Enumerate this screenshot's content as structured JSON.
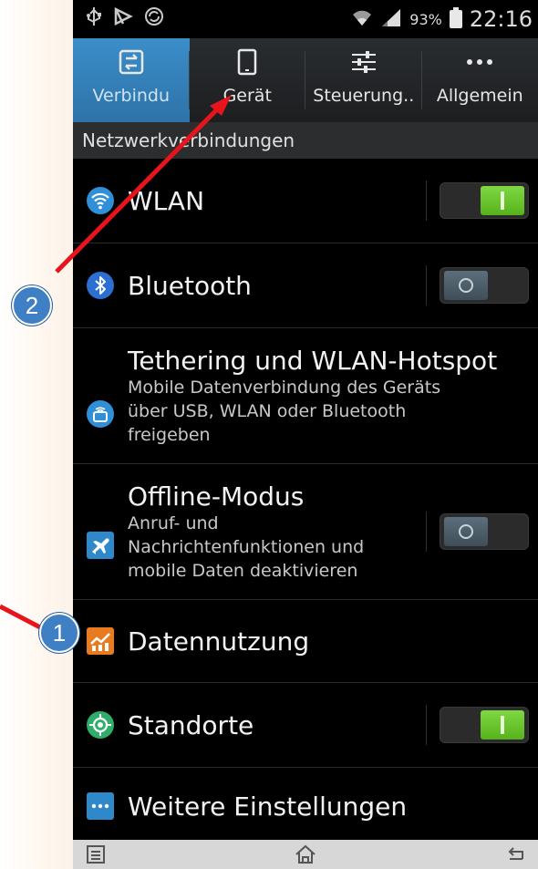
{
  "status_bar": {
    "battery_percent": "93%",
    "time": "22:16",
    "icons": [
      "usb-icon",
      "media-icon",
      "sync-icon",
      "wifi-signal-icon",
      "cell-signal-icon",
      "battery-icon"
    ]
  },
  "tabs": [
    {
      "label": "Verbindu",
      "icon": "connections-icon",
      "active": true
    },
    {
      "label": "Gerät",
      "icon": "device-icon",
      "active": false
    },
    {
      "label": "Steuerung..",
      "icon": "controls-icon",
      "active": false
    },
    {
      "label": "Allgemein",
      "icon": "more-icon",
      "active": false
    }
  ],
  "section_header": "Netzwerkverbindungen",
  "settings": {
    "wlan": {
      "title": "WLAN",
      "toggle": "on"
    },
    "bluetooth": {
      "title": "Bluetooth",
      "toggle": "off"
    },
    "tethering": {
      "title": "Tethering und WLAN-Hotspot",
      "subtitle": [
        "Mobile Datenverbindung des Geräts",
        "über USB, WLAN oder Bluetooth",
        "freigeben"
      ]
    },
    "offline": {
      "title": "Offline-Modus",
      "subtitle": [
        "Anruf- und",
        "Nachrichtenfunktionen und",
        "mobile Daten deaktivieren"
      ],
      "toggle": "off"
    },
    "data_usage": {
      "title": "Datennutzung"
    },
    "locations": {
      "title": "Standorte",
      "toggle": "on"
    },
    "more": {
      "title": "Weitere Einstellungen"
    }
  },
  "annotations": {
    "badge_1": "1",
    "badge_2": "2",
    "arrow_color": "#e8141b"
  },
  "colors": {
    "accent_tab": "#3b8dc9",
    "toggle_on": "#6cc72f",
    "toggle_off": "#4e606c",
    "badge": "#3f7fc4"
  }
}
